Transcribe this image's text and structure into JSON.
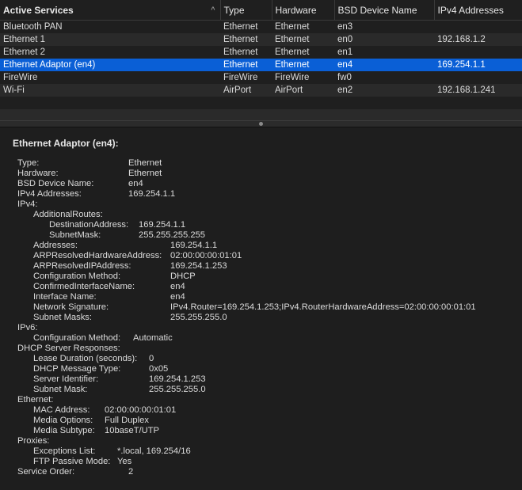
{
  "table": {
    "headers": [
      "Active Services",
      "Type",
      "Hardware",
      "BSD Device Name",
      "IPv4 Addresses"
    ],
    "sort_indicator": "^",
    "rows": [
      {
        "service": "Bluetooth PAN",
        "type": "Ethernet",
        "hardware": "Ethernet",
        "bsd": "en3",
        "ipv4": ""
      },
      {
        "service": "Ethernet 1",
        "type": "Ethernet",
        "hardware": "Ethernet",
        "bsd": "en0",
        "ipv4": "192.168.1.2"
      },
      {
        "service": "Ethernet 2",
        "type": "Ethernet",
        "hardware": "Ethernet",
        "bsd": "en1",
        "ipv4": ""
      },
      {
        "service": "Ethernet Adaptor (en4)",
        "type": "Ethernet",
        "hardware": "Ethernet",
        "bsd": "en4",
        "ipv4": "169.254.1.1",
        "selected": true
      },
      {
        "service": "FireWire",
        "type": "FireWire",
        "hardware": "FireWire",
        "bsd": "fw0",
        "ipv4": ""
      },
      {
        "service": "Wi-Fi",
        "type": "AirPort",
        "hardware": "AirPort",
        "bsd": "en2",
        "ipv4": "192.168.1.241"
      }
    ]
  },
  "details": {
    "title": "Ethernet Adaptor (en4):",
    "lines": [
      {
        "label": "Type:",
        "value": "Ethernet"
      },
      {
        "label": "Hardware:",
        "value": "Ethernet"
      },
      {
        "label": "BSD Device Name:",
        "value": "en4"
      },
      {
        "label": "IPv4 Addresses:",
        "value": "169.254.1.1"
      },
      {
        "label": "IPv4:",
        "value": ""
      },
      {
        "label": "AdditionalRoutes:",
        "value": ""
      },
      {
        "label": "DestinationAddress:",
        "value": "169.254.1.1"
      },
      {
        "label": "SubnetMask:",
        "value": "255.255.255.255"
      },
      {
        "label": "Addresses:",
        "value": "169.254.1.1"
      },
      {
        "label": "ARPResolvedHardwareAddress:",
        "value": "02:00:00:00:01:01"
      },
      {
        "label": "ARPResolvedIPAddress:",
        "value": "169.254.1.253"
      },
      {
        "label": "Configuration Method:",
        "value": "DHCP"
      },
      {
        "label": "ConfirmedInterfaceName:",
        "value": "en4"
      },
      {
        "label": "Interface Name:",
        "value": "en4"
      },
      {
        "label": "Network Signature:",
        "value": "IPv4.Router=169.254.1.253;IPv4.RouterHardwareAddress=02:00:00:00:01:01"
      },
      {
        "label": "Subnet Masks:",
        "value": "255.255.255.0"
      },
      {
        "label": "IPv6:",
        "value": ""
      },
      {
        "label": "Configuration Method:",
        "value": "Automatic"
      },
      {
        "label": "DHCP Server Responses:",
        "value": ""
      },
      {
        "label": "Lease Duration (seconds):",
        "value": "0"
      },
      {
        "label": "DHCP Message Type:",
        "value": "0x05"
      },
      {
        "label": "Server Identifier:",
        "value": "169.254.1.253"
      },
      {
        "label": "Subnet Mask:",
        "value": "255.255.255.0"
      },
      {
        "label": "Ethernet:",
        "value": ""
      },
      {
        "label": "MAC Address:",
        "value": "02:00:00:00:01:01"
      },
      {
        "label": "Media Options:",
        "value": "Full Duplex"
      },
      {
        "label": "Media Subtype:",
        "value": "10baseT/UTP"
      },
      {
        "label": "Proxies:",
        "value": ""
      },
      {
        "label": "Exceptions List:",
        "value": "*.local, 169.254/16"
      },
      {
        "label": "FTP Passive Mode:",
        "value": "Yes"
      },
      {
        "label": "Service Order:",
        "value": "2"
      }
    ]
  }
}
